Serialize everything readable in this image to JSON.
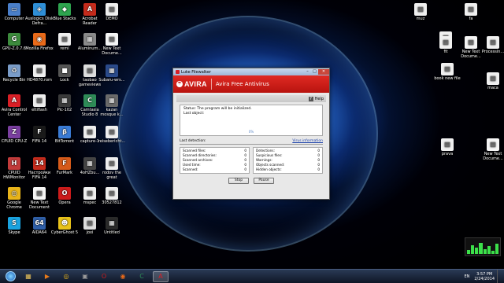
{
  "desktop_icons": [
    {
      "label": "Computer",
      "color": "#4a7fc9",
      "glyph": "▭"
    },
    {
      "label": "Auslogics Disk Defra...",
      "color": "#2f8fd6",
      "glyph": "◈"
    },
    {
      "label": "Blue Stacks",
      "color": "#2ea44f",
      "glyph": "◆"
    },
    {
      "label": "Acrobat Reader",
      "color": "#c42b1c",
      "glyph": "A"
    },
    {
      "label": "DEMO",
      "color": "#f0f0f0",
      "glyph": "▤"
    },
    {
      "label": "GPU-Z.0.7.6",
      "color": "#3d8b3d",
      "glyph": "G"
    },
    {
      "label": "Mozilla Firefox",
      "color": "#e86a1a",
      "glyph": "◉"
    },
    {
      "label": "remi",
      "color": "#eeeeee",
      "glyph": "▤"
    },
    {
      "label": "Aluminum...",
      "color": "#8a8a8a",
      "glyph": "▦"
    },
    {
      "label": "New Text Docume...",
      "color": "#f5f5f5",
      "glyph": "▤"
    },
    {
      "label": "Recycle Bin",
      "color": "#7a9cc8",
      "glyph": "♻"
    },
    {
      "label": "HD4870.rom",
      "color": "#f0f0f0",
      "glyph": "▤"
    },
    {
      "label": "Lock",
      "color": "#555555",
      "glyph": "■"
    },
    {
      "label": "taobao gameviews",
      "color": "#dddddd",
      "glyph": "▤"
    },
    {
      "label": "Subaru-wrs...",
      "color": "#2a4a8a",
      "glyph": "▦"
    },
    {
      "label": "Avira Control Center",
      "color": "#d91f26",
      "glyph": "A"
    },
    {
      "label": "eltiflash",
      "color": "#eeeeee",
      "glyph": "▤"
    },
    {
      "label": "Pic-102",
      "color": "#3a3a3a",
      "glyph": "▦"
    },
    {
      "label": "Camtasia Studio 8",
      "color": "#2e8b57",
      "glyph": "C"
    },
    {
      "label": "kazan mosque k...",
      "color": "#6a6a6a",
      "glyph": "▦"
    },
    {
      "label": "CPUID CPU-Z",
      "color": "#7b3fa0",
      "glyph": "Z"
    },
    {
      "label": "FIFA 14",
      "color": "#1a1a1a",
      "glyph": "F"
    },
    {
      "label": "BitTorrent",
      "color": "#3a7bd5",
      "glyph": "β"
    },
    {
      "label": "capture-1",
      "color": "#eeeeee",
      "glyph": "▤"
    },
    {
      "label": "reisebericht...",
      "color": "#eeeeee",
      "glyph": "▤"
    },
    {
      "label": "CPUID HWMonitor",
      "color": "#c23b3b",
      "glyph": "H"
    },
    {
      "label": "Настройки FIFA 14",
      "color": "#c42b1c",
      "glyph": "14"
    },
    {
      "label": "FurMark",
      "color": "#d65a1a",
      "glyph": "F"
    },
    {
      "label": "4oHZbu...",
      "color": "#444444",
      "glyph": "▦"
    },
    {
      "label": "rodov the great",
      "color": "#eeeeee",
      "glyph": "▤"
    },
    {
      "label": "Google Chrome",
      "color": "#e8b41a",
      "glyph": "◎"
    },
    {
      "label": "New Text Document",
      "color": "#f5f5f5",
      "glyph": "▤"
    },
    {
      "label": "Opera",
      "color": "#cc1b1b",
      "glyph": "O"
    },
    {
      "label": "mspec",
      "color": "#eeeeee",
      "glyph": "▤"
    },
    {
      "label": "30527812",
      "color": "#eeeeee",
      "glyph": "▤"
    },
    {
      "label": "Skype",
      "color": "#1aa3e0",
      "glyph": "S"
    },
    {
      "label": "AIDA64",
      "color": "#2f5fa8",
      "glyph": "64"
    },
    {
      "label": "CyberGhost 5",
      "color": "#e8c21a",
      "glyph": "☻"
    },
    {
      "label": "joxi",
      "color": "#dddddd",
      "glyph": "▤"
    },
    {
      "label": "Untitled",
      "color": "#2a2a2a",
      "glyph": "▦"
    }
  ],
  "right_icons": [
    {
      "label": "muz",
      "color": "#f0f0f0",
      "glyph": "▤"
    },
    {
      "label": "fa",
      "color": "#f0f0f0",
      "glyph": "▤"
    },
    {
      "label": "mac",
      "color": "#f0f0f0",
      "glyph": "▤"
    },
    {
      "label": "fit",
      "color": "#f0f0f0",
      "glyph": "▤"
    },
    {
      "label": "New Text Docume...",
      "color": "#f5f5f5",
      "glyph": "▤"
    },
    {
      "label": "Processin...",
      "color": "#f0f0f0",
      "glyph": "▤"
    },
    {
      "label": "book new file",
      "color": "#f0f0f0",
      "glyph": "▤"
    },
    {
      "label": "maca",
      "color": "#f0f0f0",
      "glyph": "▤"
    },
    {
      "label": "prava",
      "color": "#f0f0f0",
      "glyph": "▤"
    },
    {
      "label": "New Text Docume...",
      "color": "#f5f5f5",
      "glyph": "▤"
    }
  ],
  "window": {
    "title": "Luke Filewalker",
    "brand": "AVIRA",
    "product": "Avira Free Antivirus",
    "help": "Help",
    "status_label": "Status:",
    "status_value": "The program will be initialized.",
    "last_object": "Last object:",
    "progress": "0%",
    "last_detection": "Last detection:",
    "virus_info": "Virus information",
    "left_stats": [
      {
        "k": "Scanned files:",
        "v": "0"
      },
      {
        "k": "Scanned directories:",
        "v": "0"
      },
      {
        "k": "Scanned archives:",
        "v": "0"
      },
      {
        "k": "Used time:",
        "v": "0"
      },
      {
        "k": "Scanned:",
        "v": "0"
      }
    ],
    "right_stats": [
      {
        "k": "Detections:",
        "v": "0"
      },
      {
        "k": "Suspicious files:",
        "v": "0"
      },
      {
        "k": "Warnings:",
        "v": "0"
      },
      {
        "k": "Objects scanned:",
        "v": "0"
      },
      {
        "k": "Hidden objects:",
        "v": "0"
      }
    ],
    "stop": "Stop",
    "pause": "Pause"
  },
  "taskbar": {
    "items": [
      {
        "name": "explorer",
        "glyph": "▦",
        "color": "#e8c25a"
      },
      {
        "name": "media",
        "glyph": "▶",
        "color": "#e87a1a"
      },
      {
        "name": "chrome",
        "glyph": "◎",
        "color": "#e8b41a"
      },
      {
        "name": "cmd",
        "glyph": "▣",
        "color": "#999999"
      },
      {
        "name": "opera",
        "glyph": "O",
        "color": "#cc1b1b"
      },
      {
        "name": "firefox",
        "glyph": "◉",
        "color": "#e86a1a"
      },
      {
        "name": "camtasia",
        "glyph": "C",
        "color": "#2e8b57"
      },
      {
        "name": "avira",
        "glyph": "A",
        "color": "#d91f26"
      }
    ],
    "lang": "EN",
    "time": "3:57 PM",
    "date": "2/24/2014"
  }
}
